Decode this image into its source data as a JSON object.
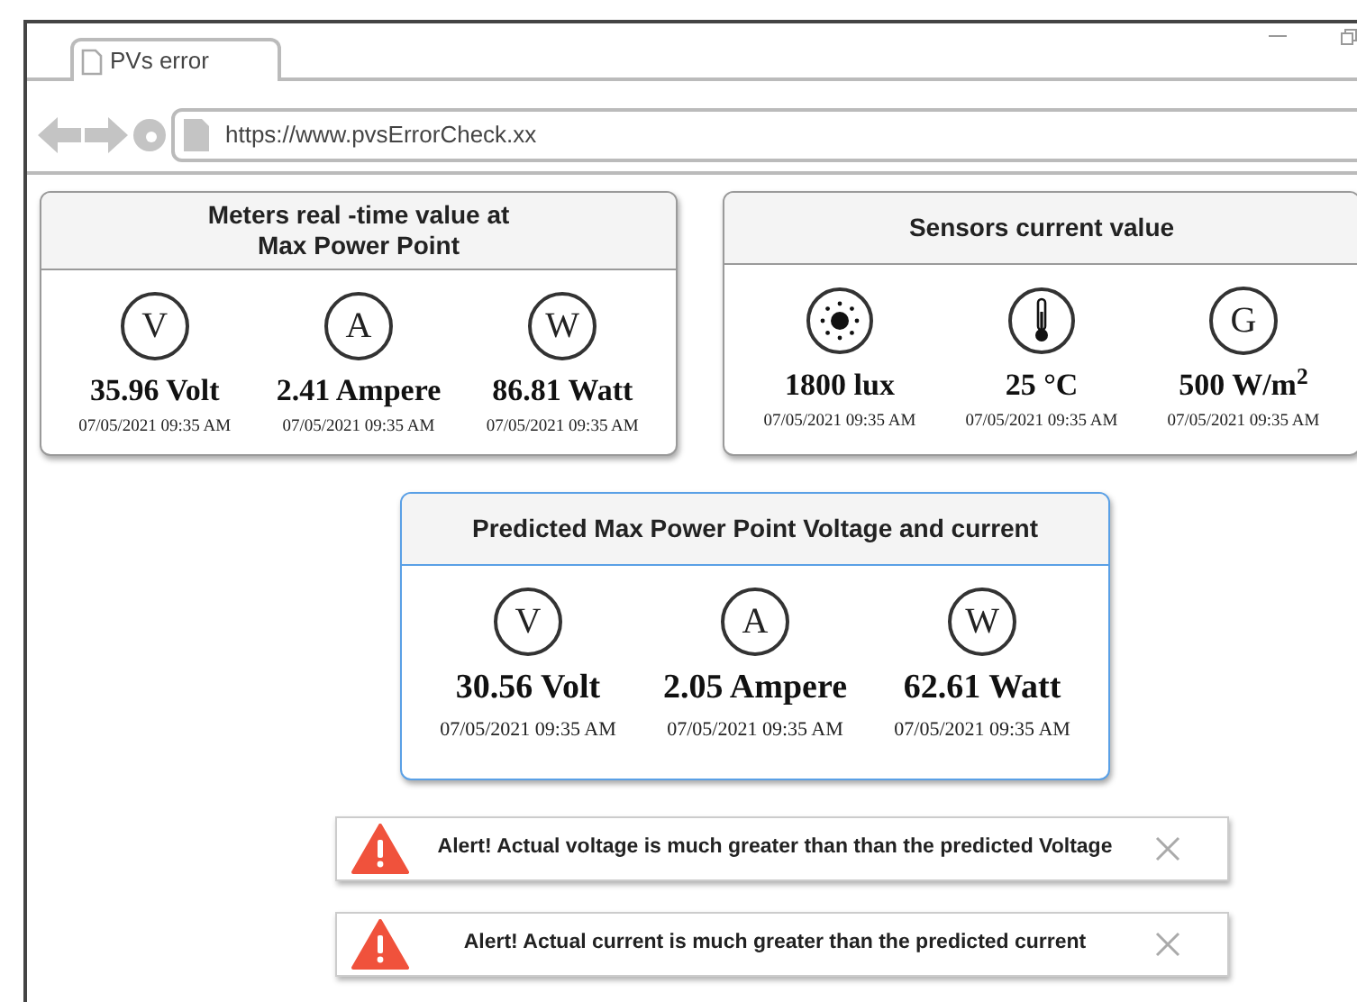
{
  "window": {
    "title": "PVs error"
  },
  "address_bar": {
    "url": "https://www.pvsErrorCheck.xx"
  },
  "meters_card": {
    "title_lines": [
      "Meters real -time value at",
      "Max Power Point"
    ],
    "items": [
      {
        "kind": "letter",
        "symbol": "V",
        "value": "35.96 Volt",
        "time": "07/05/2021 09:35 AM"
      },
      {
        "kind": "letter",
        "symbol": "A",
        "value": "2.41 Ampere",
        "time": "07/05/2021 09:35 AM"
      },
      {
        "kind": "letter",
        "symbol": "W",
        "value": "86.81 Watt",
        "time": "07/05/2021 09:35 AM"
      }
    ]
  },
  "sensors_card": {
    "title_lines": [
      "Sensors current value"
    ],
    "items": [
      {
        "kind": "sun",
        "value": "1800 lux",
        "time": "07/05/2021 09:35 AM"
      },
      {
        "kind": "thermometer",
        "value": "25 °C",
        "time": "07/05/2021 09:35 AM"
      },
      {
        "kind": "letter",
        "symbol": "G",
        "value": "500 W/m$^{2}$",
        "time": "07/05/2021 09:35 AM"
      }
    ]
  },
  "predicted_card": {
    "title_lines": [
      "Predicted Max Power Point Voltage and current"
    ],
    "items": [
      {
        "kind": "letter",
        "symbol": "V",
        "value": "30.56 Volt",
        "time": "07/05/2021 09:35 AM"
      },
      {
        "kind": "letter",
        "symbol": "A",
        "value": "2.05 Ampere",
        "time": "07/05/2021 09:35 AM"
      },
      {
        "kind": "letter",
        "symbol": "W",
        "value": "62.61 Watt",
        "time": "07/05/2021 09:35 AM"
      }
    ]
  },
  "alerts": [
    {
      "message": "Alert! Actual voltage is much greater than than the predicted Voltage"
    },
    {
      "message": "Alert! Actual current is much greater than the predicted current"
    }
  ]
}
